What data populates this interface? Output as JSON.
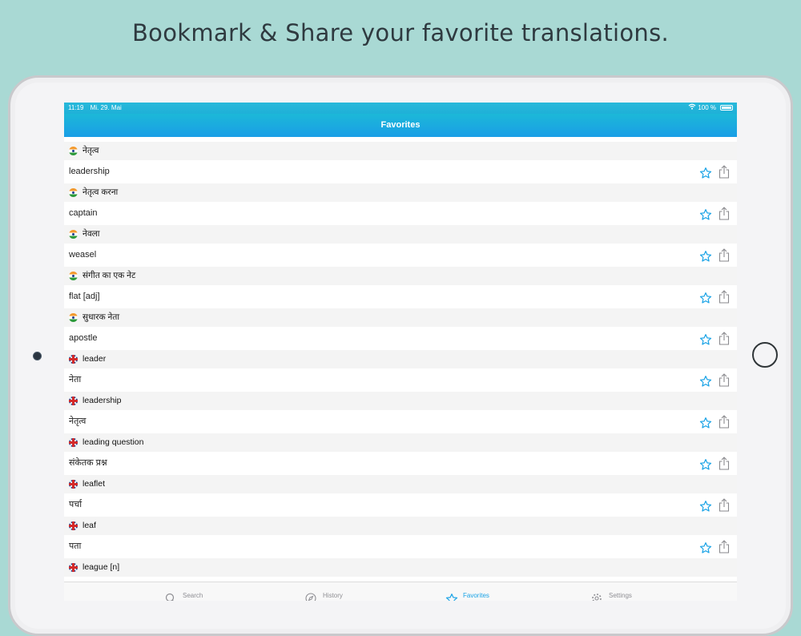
{
  "headline": "Bookmark & Share your  favorite translations.",
  "status_bar": {
    "time": "11:19",
    "date": "Mi. 29. Mai",
    "battery": "100 %"
  },
  "nav": {
    "title": "Favorites"
  },
  "favorites": [
    {
      "flag": "in",
      "term": "नेतृत्व",
      "translation": "leadership"
    },
    {
      "flag": "in",
      "term": "नेतृत्व करना",
      "translation": "captain"
    },
    {
      "flag": "in",
      "term": "नेवला",
      "translation": "weasel"
    },
    {
      "flag": "in",
      "term": "संगीत का एक नेट",
      "translation": "flat [adj]"
    },
    {
      "flag": "in",
      "term": "सुधारक नेता",
      "translation": "apostle"
    },
    {
      "flag": "gb",
      "term": "leader",
      "translation": "नेता"
    },
    {
      "flag": "gb",
      "term": "leadership",
      "translation": "नेतृत्व"
    },
    {
      "flag": "gb",
      "term": "leading question",
      "translation": "संकेतक प्रश्न"
    },
    {
      "flag": "gb",
      "term": "leaflet",
      "translation": "पर्चा"
    },
    {
      "flag": "gb",
      "term": "leaf",
      "translation": "पता"
    },
    {
      "flag": "gb",
      "term": "league [n]",
      "translation": ""
    }
  ],
  "tabs": [
    {
      "label": "Search",
      "icon": "search-icon",
      "active": false
    },
    {
      "label": "History",
      "icon": "compass-icon",
      "active": false
    },
    {
      "label": "Favorites",
      "icon": "star-icon",
      "active": true
    },
    {
      "label": "Settings",
      "icon": "gear-icon",
      "active": false
    }
  ],
  "colors": {
    "background": "#a9d9d4",
    "accent": "#1aa3e6",
    "nav_gradient_top": "#1cb8d8",
    "nav_gradient_bottom": "#1a9ee6"
  }
}
